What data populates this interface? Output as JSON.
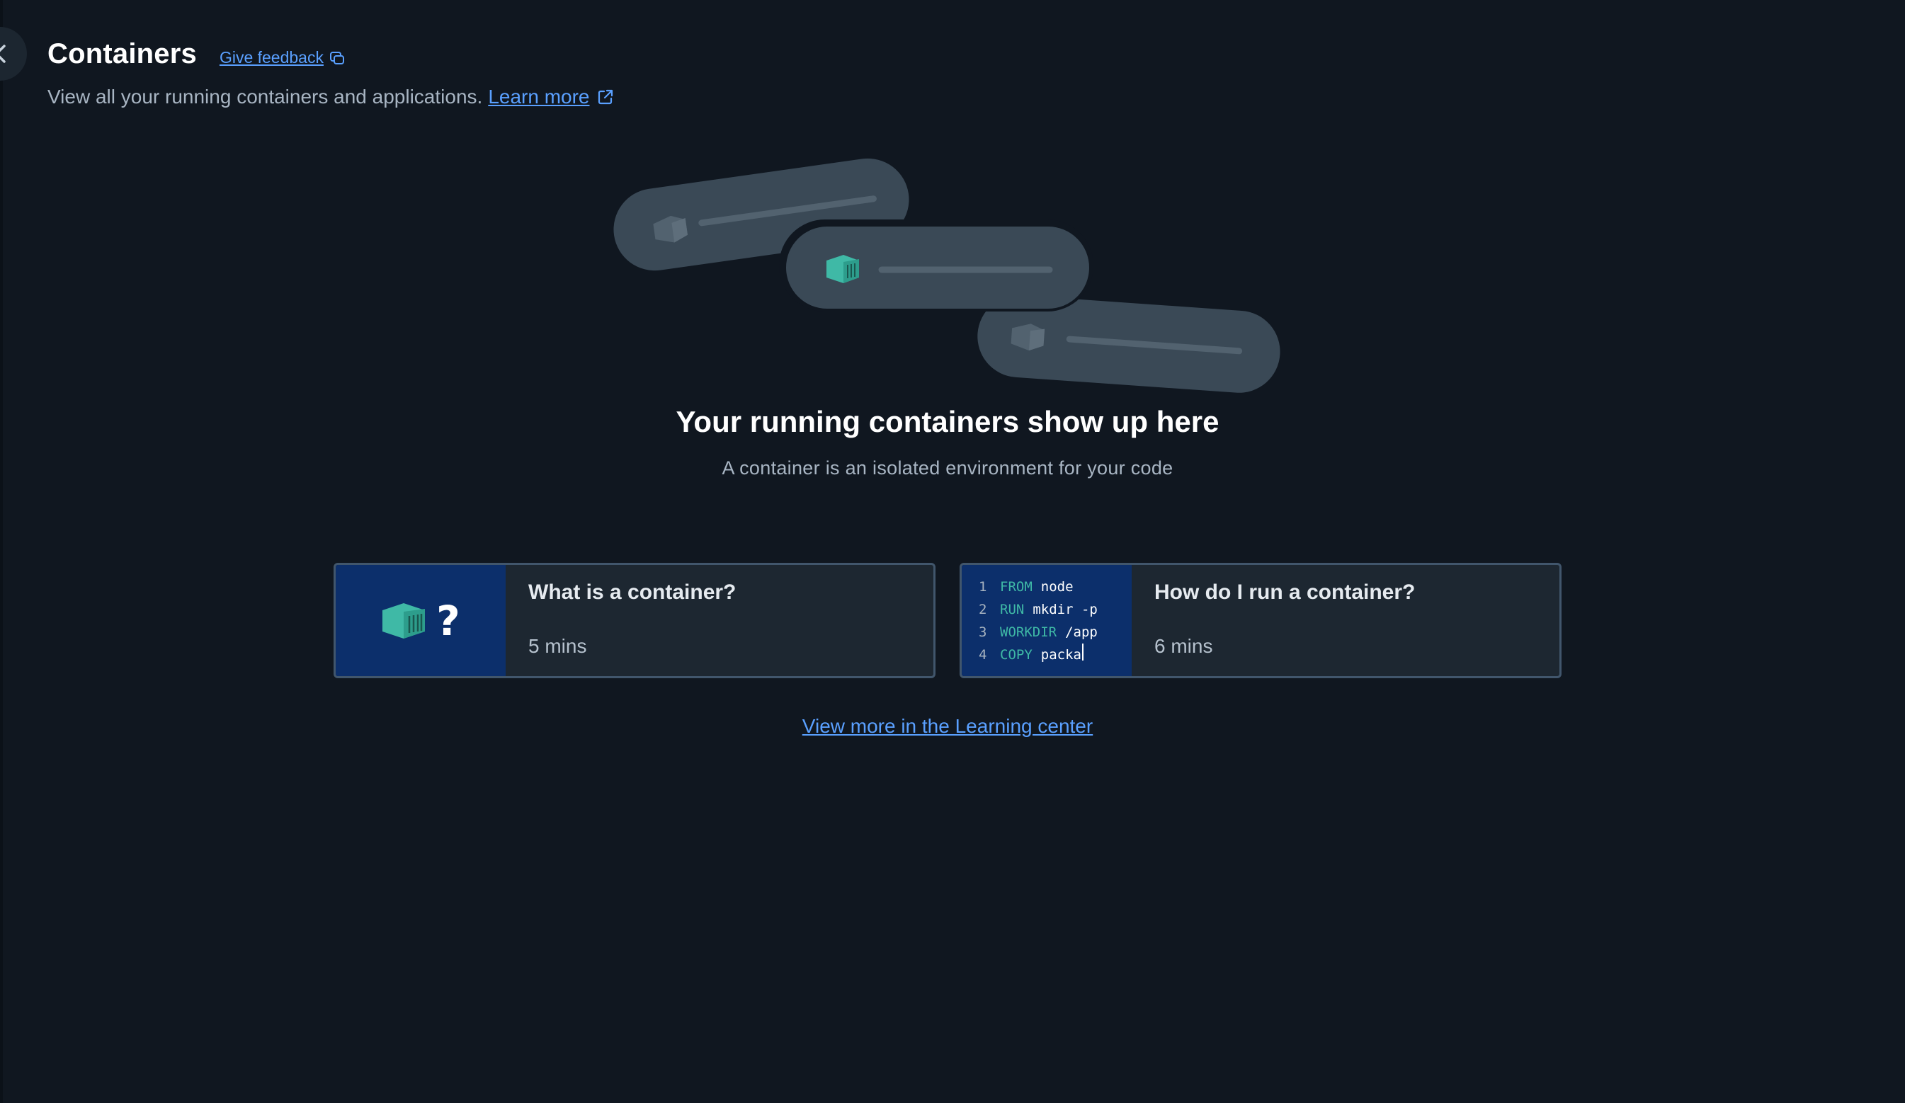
{
  "header": {
    "back_icon": "chevron-left-icon",
    "title": "Containers",
    "feedback_label": "Give feedback",
    "feedback_icon": "feedback-icon",
    "subtitle": "View all your running containers and applications.",
    "learn_more_label": "Learn more",
    "learn_more_icon": "external-link-icon"
  },
  "empty_state": {
    "title": "Your running containers show up here",
    "subtitle": "A container is an isolated environment for your code"
  },
  "cards": [
    {
      "title": "What is a container?",
      "duration": "5 mins",
      "thumb_icon": "container-question-icon",
      "thumb_symbol": "?"
    },
    {
      "title": "How do I run a container?",
      "duration": "6 mins",
      "code": [
        {
          "num": "1",
          "kw": "FROM",
          "arg": "node"
        },
        {
          "num": "2",
          "kw": "RUN",
          "arg": "mkdir -p"
        },
        {
          "num": "3",
          "kw": "WORKDIR",
          "arg": "/app"
        },
        {
          "num": "4",
          "kw": "COPY",
          "arg": "packa"
        }
      ]
    }
  ],
  "view_more_label": "View more in the Learning center",
  "colors": {
    "background": "#101720",
    "accent_link": "#5aa0ff",
    "container_teal": "#3fb9a6",
    "card_thumb_bg": "#0c2f6b"
  }
}
